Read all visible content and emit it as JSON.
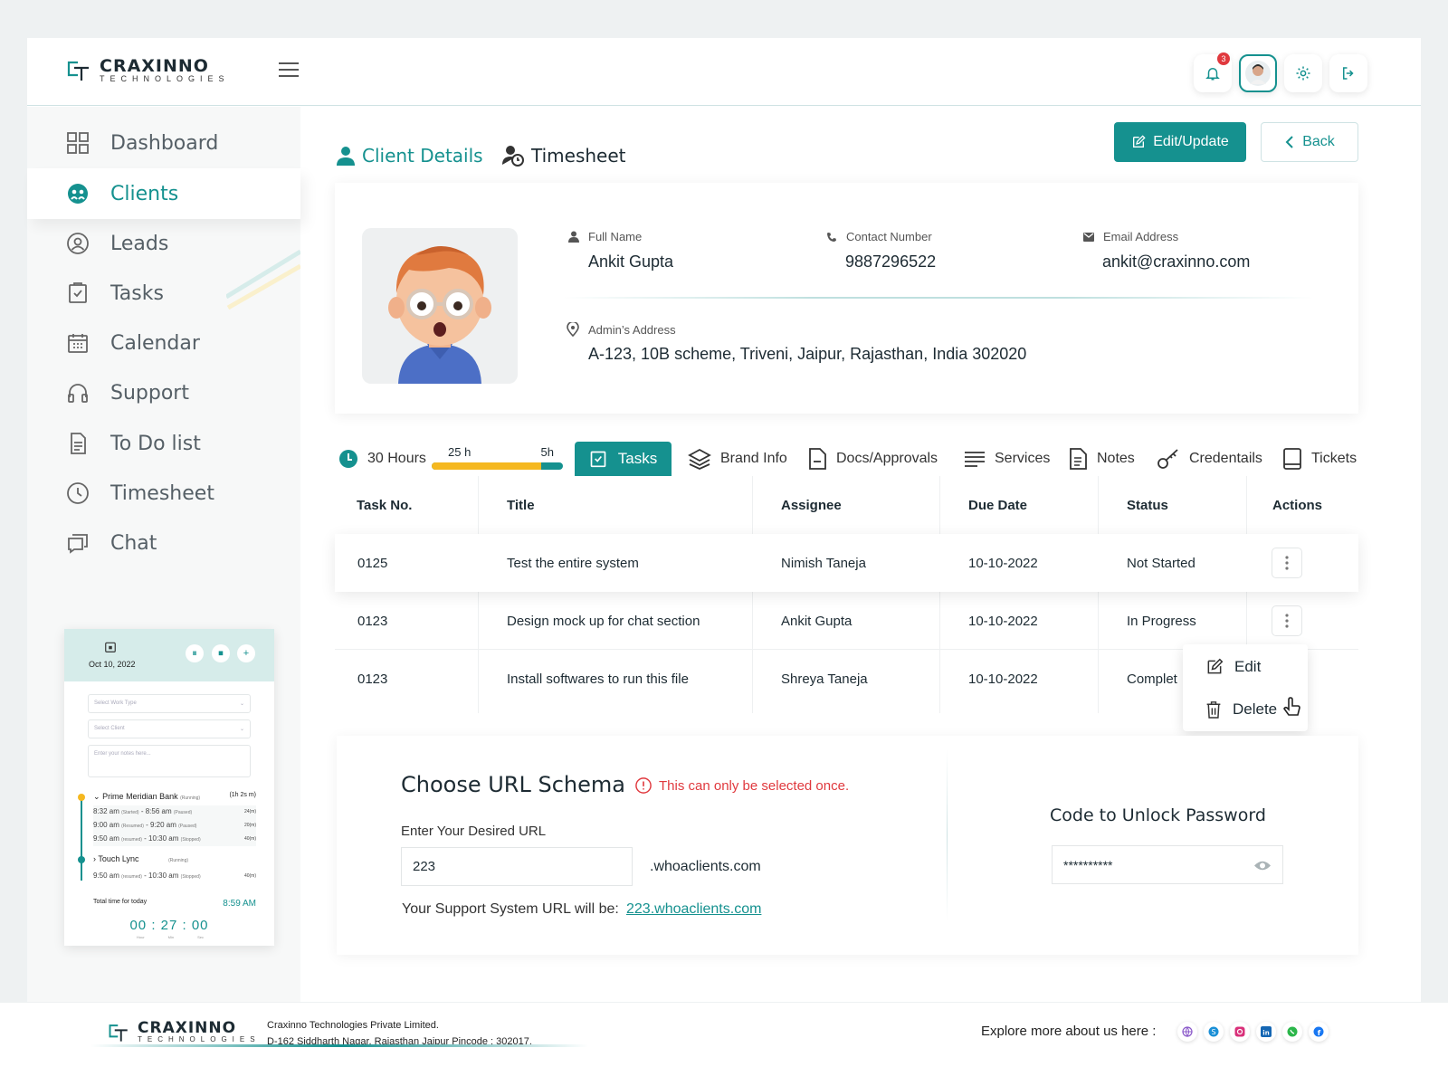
{
  "brand": {
    "name": "CRAXINNO",
    "sub": "TECHNOLOGIES"
  },
  "topbar": {
    "notification_count": "3"
  },
  "sidebar": {
    "items": [
      {
        "label": "Dashboard",
        "icon": "grid-icon"
      },
      {
        "label": "Clients",
        "icon": "clients-icon"
      },
      {
        "label": "Leads",
        "icon": "user-circle-icon"
      },
      {
        "label": "Tasks",
        "icon": "clipboard-check-icon"
      },
      {
        "label": "Calendar",
        "icon": "calendar-icon"
      },
      {
        "label": "Support",
        "icon": "headset-icon"
      },
      {
        "label": "To Do list",
        "icon": "document-icon"
      },
      {
        "label": "Timesheet",
        "icon": "clock-icon"
      },
      {
        "label": "Chat",
        "icon": "chat-icon"
      }
    ],
    "active": "Clients"
  },
  "widget": {
    "date": "Oct 10, 2022",
    "work_type_placeholder": "Select Work Type",
    "client_placeholder": "Select Client",
    "notes_placeholder": "Enter your notes here...",
    "entries": [
      {
        "client": "Prime Meridian Bank",
        "state": "(Running)",
        "total": "(1h 2s m)",
        "logs": [
          {
            "text": "8:32 am",
            "s1": "(Started)",
            "mid": "- 8:56 am",
            "s2": "(Paused)",
            "dur": "24(m)"
          },
          {
            "text": "9:00 am",
            "s1": "(Resumed)",
            "mid": "- 9:20 am",
            "s2": "(Paused)",
            "dur": "20(m)"
          },
          {
            "text": "9:50 am",
            "s1": "(resumed)",
            "mid": "- 10:30 am",
            "s2": "(Stopped)",
            "dur": "40(m)"
          }
        ]
      },
      {
        "client": "Touch Lync",
        "state": "(Running)",
        "total": "",
        "logs": [
          {
            "text": "9:50 am",
            "s1": "(resumed)",
            "mid": "- 10:30 am",
            "s2": "(Stopped)",
            "dur": "40(m)"
          }
        ]
      }
    ],
    "total_label": "Total time for today",
    "total_time": "8:59 AM",
    "clock": "00 : 27 : 00",
    "clock_units": [
      "Hour",
      "Min",
      "Sec"
    ]
  },
  "page_tabs": {
    "client_details": "Client Details",
    "timesheet": "Timesheet"
  },
  "actions": {
    "edit": "Edit/Update",
    "back": "Back"
  },
  "client": {
    "full_name_label": "Full Name",
    "full_name": "Ankit Gupta",
    "contact_label": "Contact Number",
    "contact": "9887296522",
    "email_label": "Email Address",
    "email": "ankit@craxinno.com",
    "address_label": "Admin’s Address",
    "address": "A-123, 10B scheme, Triveni, Jaipur, Rajasthan, India 302020"
  },
  "hours": {
    "total": "30 Hours",
    "used": "25 h",
    "remaining": "5h",
    "used_fraction": 0.8333
  },
  "tabs": [
    "Tasks",
    "Brand Info",
    "Docs/Approvals",
    "Services",
    "Notes",
    "Credentails",
    "Tickets"
  ],
  "table": {
    "headers": [
      "Task No.",
      "Title",
      "Assignee",
      "Due Date",
      "Status",
      "Actions"
    ],
    "rows": [
      {
        "no": "0125",
        "title": "Test the entire system",
        "assignee": "Nimish Taneja",
        "due": "10-10-2022",
        "status": "Not Started"
      },
      {
        "no": "0123",
        "title": "Design mock up for chat section",
        "assignee": "Ankit Gupta",
        "due": "10-10-2022",
        "status": "In Progress"
      },
      {
        "no": "0123",
        "title": "Install softwares to run this file",
        "assignee": "Shreya Taneja",
        "due": "10-10-2022",
        "status": "Complet"
      }
    ]
  },
  "row_menu": {
    "edit": "Edit",
    "delete": "Delete"
  },
  "url_schema": {
    "title": "Choose URL Schema",
    "warning": "This can only be selected once.",
    "input_label": "Enter Your Desired URL",
    "input_value": "223",
    "suffix": ".whoaclients.com",
    "result_label": "Your Support System URL will be:",
    "result_link": "223.whoaclients.com",
    "unlock_title": "Code to Unlock Password",
    "password": "**********"
  },
  "footer": {
    "company": "Craxinno Technologies Private Limited.",
    "address": "D-162 Siddharth Nagar, Rajasthan Jaipur Pincode : 302017.",
    "explore": "Explore more about us here :",
    "social": [
      "globe-icon",
      "skype-icon",
      "instagram-icon",
      "linkedin-icon",
      "whatsapp-icon",
      "facebook-icon"
    ]
  },
  "colors": {
    "accent": "#15918f",
    "warning": "#e0393e",
    "progress_used": "#f5b820"
  }
}
